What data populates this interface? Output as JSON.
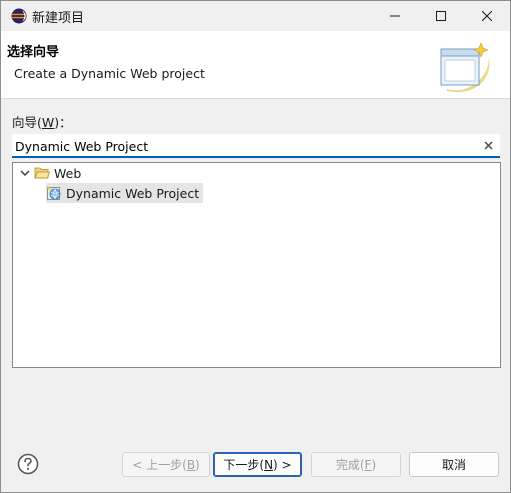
{
  "window": {
    "title": "新建项目",
    "icon": "eclipse-icon"
  },
  "banner": {
    "title": "选择向导",
    "description": "Create a Dynamic Web project"
  },
  "wizard": {
    "label_prefix": "向导(",
    "label_mnemonic": "W",
    "label_suffix": ")：",
    "filter_value": "Dynamic Web Project"
  },
  "tree": {
    "items": [
      {
        "label": "Web",
        "icon": "folder-open-icon",
        "expanded": true
      },
      {
        "label": "Dynamic Web Project",
        "icon": "web-project-icon",
        "selected": true
      }
    ]
  },
  "buttons": {
    "back_prefix": "< 上一步(",
    "back_mnemonic": "B",
    "back_suffix": ")",
    "next_prefix": "下一步(",
    "next_mnemonic": "N",
    "next_suffix": ") >",
    "finish_prefix": "完成(",
    "finish_mnemonic": "F",
    "finish_suffix": ")",
    "cancel": "取消"
  },
  "colors": {
    "accent": "#005fb8",
    "selection": "#e5e5e5",
    "disabled_text": "#a0a0a0"
  }
}
